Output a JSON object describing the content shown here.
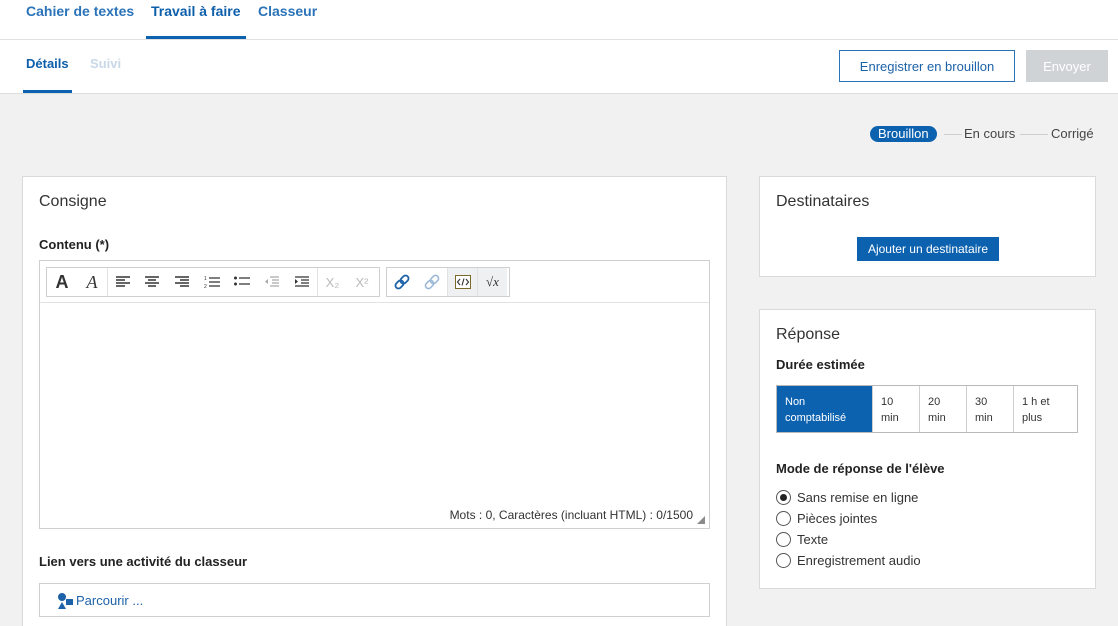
{
  "top_tabs": [
    "Cahier de textes",
    "Travail à faire",
    "Classeur"
  ],
  "sub_tabs": [
    "Détails",
    "Suivi"
  ],
  "actions": {
    "draft": "Enregistrer en brouillon",
    "send": "Envoyer"
  },
  "status_steps": [
    "Brouillon",
    "En cours",
    "Corrigé"
  ],
  "consigne": {
    "title": "Consigne",
    "content_label": "Contenu (*)",
    "counter": "Mots : 0, Caractères (incluant HTML) : 0/1500",
    "link_label": "Lien vers une activité du classeur",
    "browse": "Parcourir ..."
  },
  "toolbar": {
    "font_bold": "A",
    "font_italic": "A",
    "subscript": "X₂",
    "superscript": "X²",
    "formula": "√x"
  },
  "destinataires": {
    "title": "Destinataires",
    "add_button": "Ajouter un destinataire"
  },
  "reponse": {
    "title": "Réponse",
    "duration_label": "Durée estimée",
    "durations": [
      "Non comptabilisé",
      "10 min",
      "20 min",
      "30 min",
      "1 h et plus"
    ],
    "mode_label": "Mode de réponse de l'élève",
    "modes": [
      "Sans remise en ligne",
      "Pièces jointes",
      "Texte",
      "Enregistrement audio"
    ]
  },
  "colors": {
    "primary": "#0d62b0",
    "link": "#2a73b8",
    "disabled": "#cfd3d6"
  }
}
